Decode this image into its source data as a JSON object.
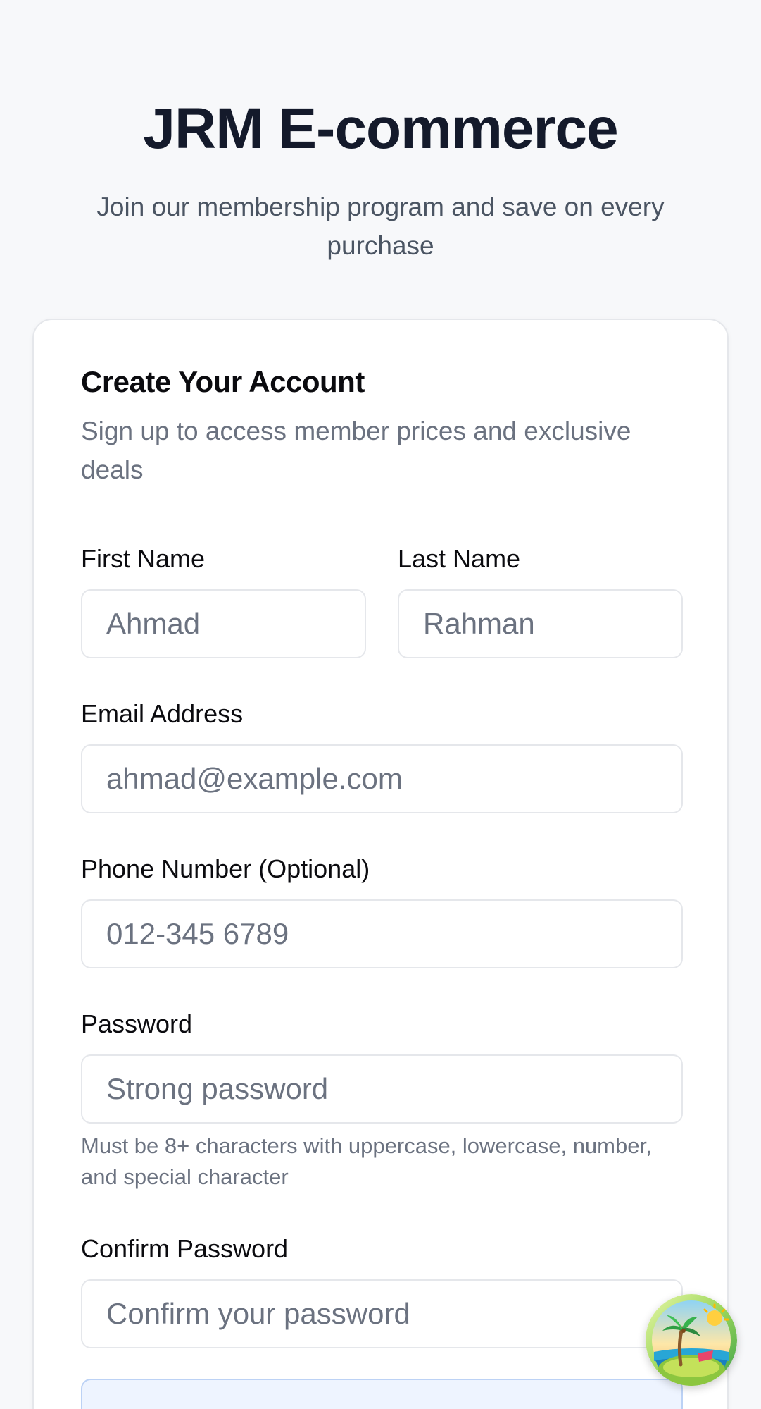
{
  "header": {
    "title": "JRM E-commerce",
    "subtitle": "Join our membership program and save on every purchase"
  },
  "card": {
    "title": "Create Your Account",
    "subtitle": "Sign up to access member prices and exclusive deals"
  },
  "form": {
    "first_name": {
      "label": "First Name",
      "placeholder": "Ahmad"
    },
    "last_name": {
      "label": "Last Name",
      "placeholder": "Rahman"
    },
    "email": {
      "label": "Email Address",
      "placeholder": "ahmad@example.com"
    },
    "phone": {
      "label": "Phone Number (Optional)",
      "placeholder": "012-345 6789"
    },
    "password": {
      "label": "Password",
      "placeholder": "Strong password",
      "hint": "Must be 8+ characters with uppercase, lowercase, number, and special character"
    },
    "confirm_password": {
      "label": "Confirm Password",
      "placeholder": "Confirm your password"
    }
  },
  "floating_button": {
    "icon": "tropical-island-icon"
  },
  "colors": {
    "background": "#f7f8fa",
    "title": "#141a2b",
    "muted_text": "#6b7280",
    "input_border": "#e5e7eb",
    "info_box_background": "#eef4ff",
    "info_box_border": "#bcd2f5"
  }
}
